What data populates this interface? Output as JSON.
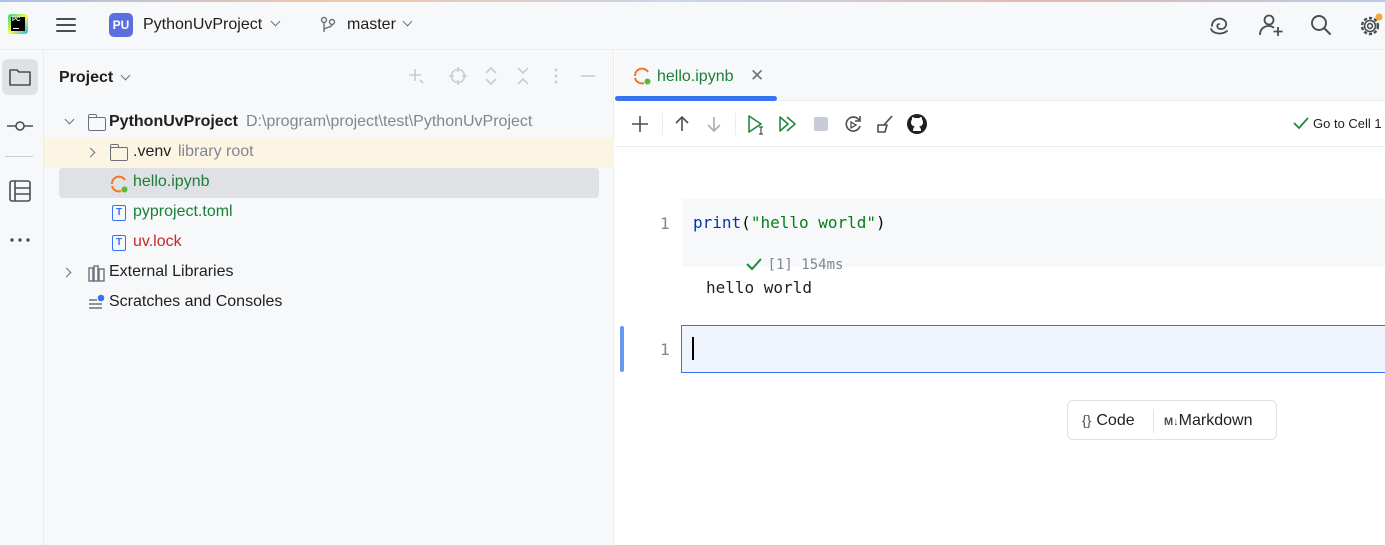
{
  "header": {
    "project_badge": "PU",
    "project_name": "PythonUvProject",
    "branch": "master",
    "icons": [
      "jetbrains-ai-icon",
      "add-user-icon",
      "search-icon",
      "settings-icon"
    ],
    "notification_color": "#f2a93b"
  },
  "toolstrip": {
    "icons": [
      "project-folder-icon",
      "commit-icon",
      "structure-icon",
      "more-icon"
    ]
  },
  "project_panel": {
    "title": "Project",
    "tree": {
      "root_name": "PythonUvProject",
      "root_path": "D:\\program\\project\\test\\PythonUvProject",
      "venv_name": ".venv",
      "venv_hint": "library root",
      "notebook_file": "hello.ipynb",
      "toml_file": "pyproject.toml",
      "lock_file": "uv.lock",
      "external_libraries": "External Libraries",
      "scratches": "Scratches and Consoles"
    },
    "colors": {
      "added_file": "#1a7f37",
      "modified_file": "#c62828"
    }
  },
  "editor": {
    "tab_label": "hello.ipynb",
    "goto_cell": "Go to Cell 1",
    "cell1": {
      "line_number": "1",
      "code_fn": "print",
      "code_open": "(",
      "code_str": "\"hello world\"",
      "code_close": ")",
      "exec_info": "[1] 154ms",
      "output": "hello world"
    },
    "cell2": {
      "line_number": "1"
    },
    "add_cell": {
      "code_label": "Code",
      "markdown_label": "Markdown",
      "markdown_glyph": "M↓"
    }
  }
}
